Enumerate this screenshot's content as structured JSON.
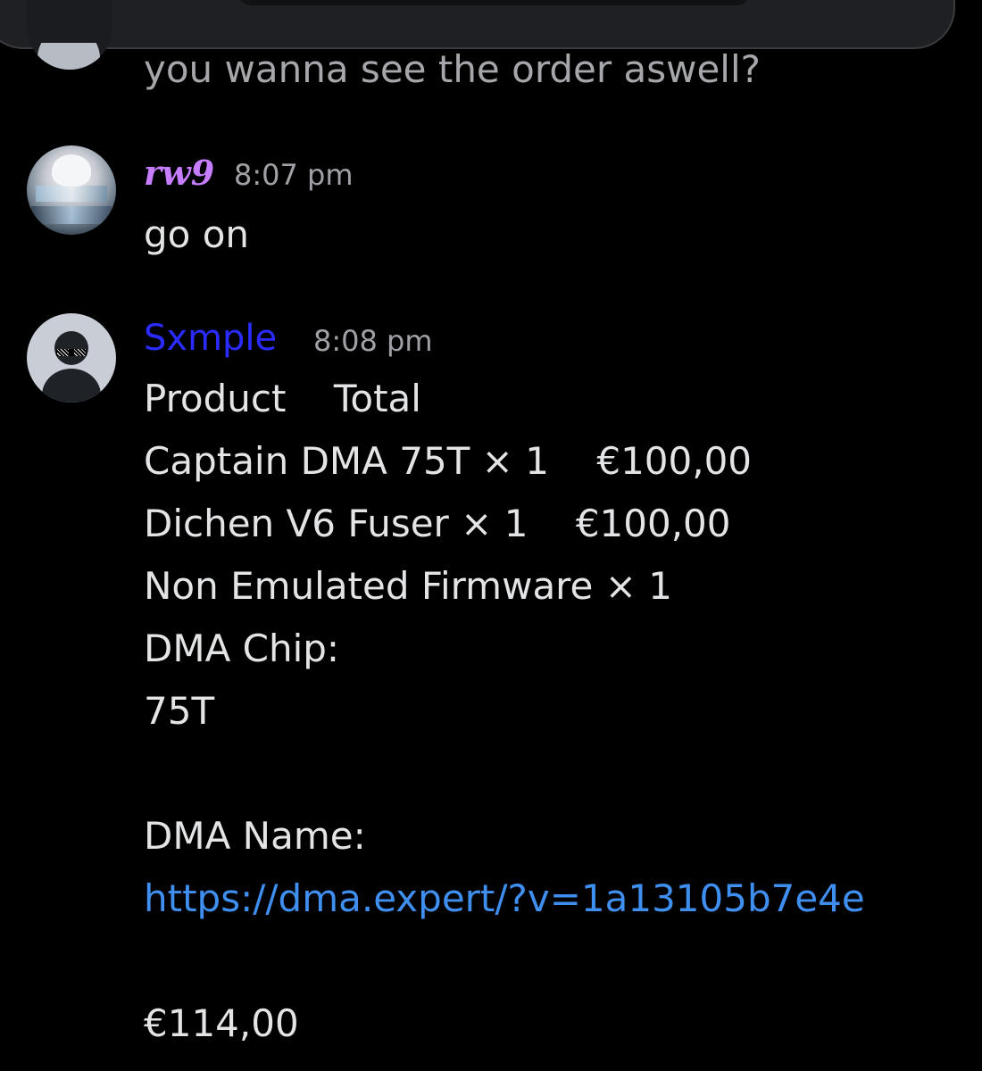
{
  "colors": {
    "background": "#000000",
    "text": "#e3e4e6",
    "timestamp": "#a0a1a6",
    "rw9_name": "#c77dff",
    "sxmple_name": "#2a2bff",
    "link": "#3f8ff0"
  },
  "previous_message": {
    "text": "you wanna see the order aswell?"
  },
  "messages": [
    {
      "author": "rw9",
      "timestamp": "8:07 pm",
      "lines": [
        "go on"
      ]
    },
    {
      "author": "Sxmple",
      "timestamp": "8:08 pm",
      "lines": [
        "Product    Total",
        "Captain DMA 75T × 1    €100,00",
        "Dichen V6 Fuser × 1    €100,00",
        "Non Emulated Firmware × 1",
        "DMA Chip:",
        "75T",
        "DMA Name:"
      ],
      "link": "https://dma.expert/?v=1a13105b7e4e",
      "total": "€114,00"
    }
  ]
}
